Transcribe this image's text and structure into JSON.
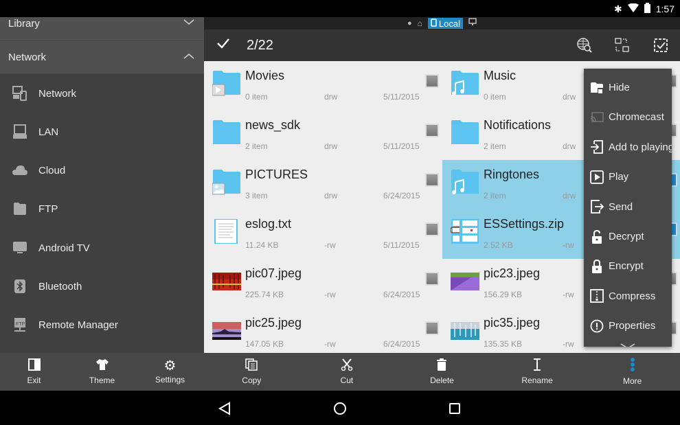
{
  "status_bar": {
    "time": "1:57",
    "icons": [
      "bluetooth-icon",
      "wifi-icon",
      "battery-icon"
    ]
  },
  "sidebar": {
    "library_label": "Library",
    "network_label": "Network",
    "items": [
      {
        "label": "Network",
        "icon": "network-devices-icon"
      },
      {
        "label": "LAN",
        "icon": "computer-icon"
      },
      {
        "label": "Cloud",
        "icon": "cloud-icon"
      },
      {
        "label": "FTP",
        "icon": "ftp-icon"
      },
      {
        "label": "Android TV",
        "icon": "tv-icon"
      },
      {
        "label": "Bluetooth",
        "icon": "bluetooth-icon"
      },
      {
        "label": "Remote Manager",
        "icon": "remote-manager-icon"
      }
    ],
    "bottom": [
      {
        "label": "Exit",
        "icon": "exit-icon"
      },
      {
        "label": "Theme",
        "icon": "shirt-icon"
      },
      {
        "label": "Settings",
        "icon": "gear-icon"
      }
    ]
  },
  "location_bar": {
    "local_label": "Local"
  },
  "toolbar": {
    "selection_count": "2/22"
  },
  "files": [
    {
      "name": "Movies",
      "size": "0 item",
      "perm": "drw",
      "date": "5/11/2015",
      "type": "folder-video",
      "selected": false
    },
    {
      "name": "Music",
      "size": "0 item",
      "perm": "drw",
      "date": "",
      "type": "folder-music",
      "selected": false
    },
    {
      "name": "news_sdk",
      "size": "2 item",
      "perm": "drw",
      "date": "5/11/2015",
      "type": "folder",
      "selected": false
    },
    {
      "name": "Notifications",
      "size": "2 item",
      "perm": "drw",
      "date": "",
      "type": "folder",
      "selected": false
    },
    {
      "name": "PICTURES",
      "size": "3 item",
      "perm": "drw",
      "date": "6/24/2015",
      "type": "folder-pictures",
      "selected": false
    },
    {
      "name": "Ringtones",
      "size": "2 item",
      "perm": "drw",
      "date": "",
      "type": "folder-music",
      "selected": true
    },
    {
      "name": "eslog.txt",
      "size": "11.24 KB",
      "perm": "-rw",
      "date": "5/11/2015",
      "type": "text",
      "selected": false
    },
    {
      "name": "ESSettings.zip",
      "size": "2.52 KB",
      "perm": "-rw",
      "date": "",
      "type": "zip",
      "selected": true
    },
    {
      "name": "pic07.jpeg",
      "size": "225.74 KB",
      "perm": "-rw",
      "date": "6/24/2015",
      "type": "image-red",
      "selected": false
    },
    {
      "name": "pic23.jpeg",
      "size": "156.29 KB",
      "perm": "-rw",
      "date": "",
      "type": "image-purple",
      "selected": false
    },
    {
      "name": "pic25.jpeg",
      "size": "147.05 KB",
      "perm": "-rw",
      "date": "6/24/2015",
      "type": "image-dusk",
      "selected": false
    },
    {
      "name": "pic35.jpeg",
      "size": "135.35 KB",
      "perm": "-rw",
      "date": "",
      "type": "image-teal",
      "selected": false
    }
  ],
  "action_bar": [
    {
      "label": "Copy",
      "icon": "copy-icon"
    },
    {
      "label": "Cut",
      "icon": "scissors-icon"
    },
    {
      "label": "Delete",
      "icon": "trash-icon"
    },
    {
      "label": "Rename",
      "icon": "text-cursor-icon"
    },
    {
      "label": "More",
      "icon": "more-vertical-icon"
    }
  ],
  "context_menu": [
    {
      "label": "Hide",
      "icon": "hide-folder-icon"
    },
    {
      "label": "Chromecast",
      "icon": "cast-icon"
    },
    {
      "label": "Add to playing",
      "icon": "add-to-playlist-icon"
    },
    {
      "label": "Play",
      "icon": "play-icon"
    },
    {
      "label": "Send",
      "icon": "send-icon"
    },
    {
      "label": "Decrypt",
      "icon": "unlock-icon"
    },
    {
      "label": "Encrypt",
      "icon": "lock-icon"
    },
    {
      "label": "Compress",
      "icon": "zip-icon"
    },
    {
      "label": "Properties",
      "icon": "info-icon"
    }
  ],
  "colors": {
    "accent": "#1f88c7",
    "selection": "#8dd0e8",
    "folder": "#5bc3f0"
  }
}
